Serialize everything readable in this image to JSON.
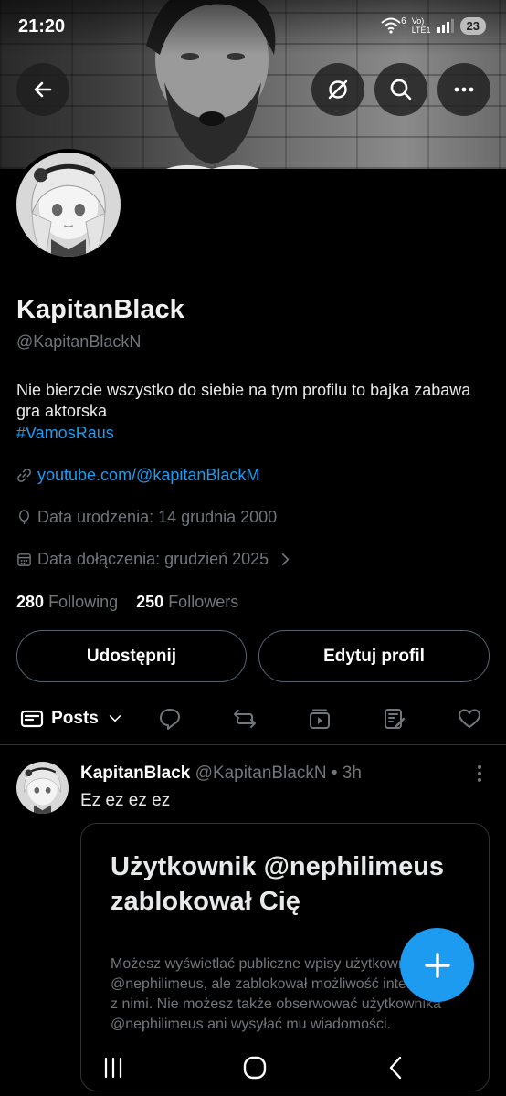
{
  "status_bar": {
    "time": "21:20",
    "network_top": "Vo)",
    "network_bottom": "LTE1",
    "wifi_badge": "6",
    "battery": "23"
  },
  "header": {
    "back_icon": "arrow-left-icon",
    "grok_icon": "grok-icon",
    "search_icon": "search-icon",
    "more_icon": "more-horizontal-icon"
  },
  "profile": {
    "name": "KapitanBlack",
    "handle": "@KapitanBlackN",
    "bio": "Nie bierzcie wszystko do siebie na tym profilu to bajka zabawa gra aktorska",
    "hashtag": "#VamosRaus",
    "link": "youtube.com/@kapitanBlackM",
    "birth": "Data urodzenia: 14 grudnia 2000",
    "joined": "Data dołączenia: grudzień 2025",
    "following_count": "280",
    "following_label": "Following",
    "followers_count": "250",
    "followers_label": "Followers",
    "share_button": "Udostępnij",
    "edit_button": "Edytuj profil"
  },
  "tabs": {
    "posts_label": "Posts",
    "icons": [
      "posts-icon",
      "replies-icon",
      "reposts-icon",
      "video-icon",
      "articles-icon",
      "likes-icon"
    ]
  },
  "post": {
    "author_name": "KapitanBlack",
    "author_handle": "@KapitanBlackN",
    "separator": "•",
    "time": "3h",
    "text": "Ez ez ez ez",
    "card_title": "Użytkownik @nephilimeus zablokował Cię",
    "card_body": "Możesz wyświetlać publiczne wpisy użytkownika @nephilimeus, ale zablokował możliwość interakcji z nimi. Nie możesz także obserwować użytkownika @nephilimeus ani wysyłać mu wiadomości."
  },
  "fab": {
    "icon": "plus-icon"
  },
  "system_nav": {
    "icons": [
      "recents-icon",
      "home-icon",
      "back-icon"
    ]
  },
  "colors": {
    "accent": "#1d9bf0",
    "background": "#000000",
    "muted": "#71767b",
    "border": "#2f3336"
  }
}
